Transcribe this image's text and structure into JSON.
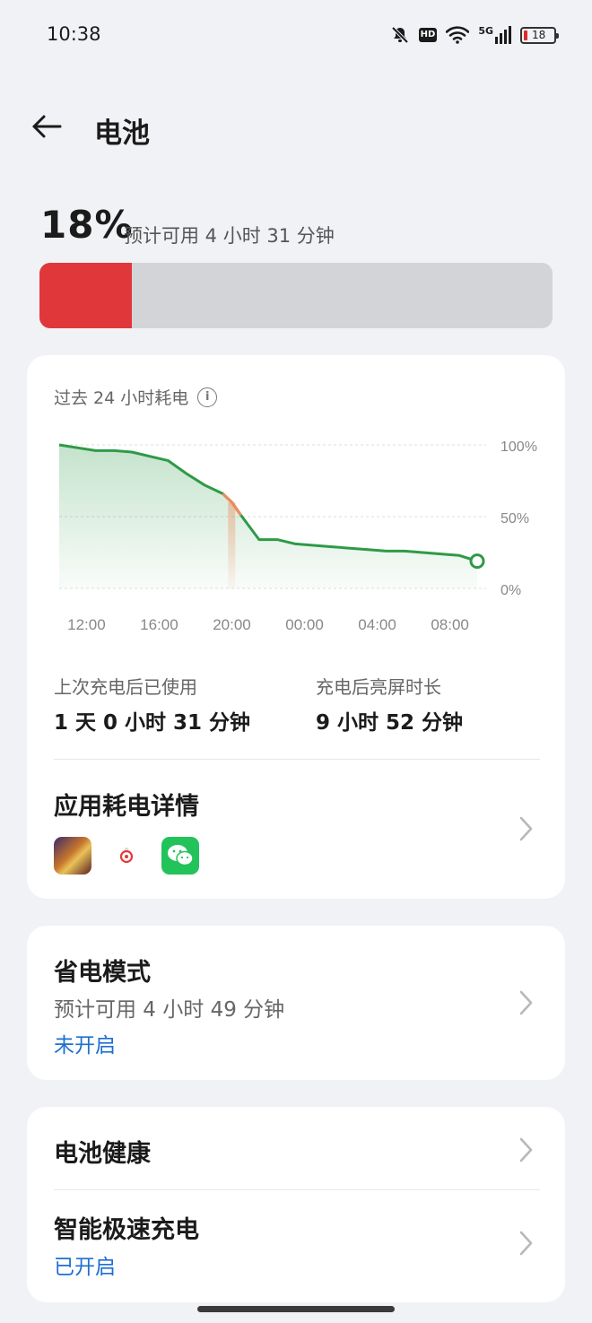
{
  "status": {
    "time": "10:38",
    "icons": [
      "mute-bell-icon",
      "hd-icon",
      "wifi-icon",
      "5g-signal-icon",
      "battery-icon"
    ],
    "hd_label": "HD",
    "net_label": "5G",
    "battery_level": "18"
  },
  "header": {
    "title": "电池"
  },
  "battery": {
    "percent_text": "18%",
    "percent_value": 18,
    "estimate": "预计可用 4 小时 31 分钟",
    "fill_color": "#e0383a"
  },
  "usage_card": {
    "title": "过去 24 小时耗电",
    "last_charge_label": "上次充电后已使用",
    "last_charge_value": "1 天 0 小时 31 分钟",
    "screen_on_label": "充电后亮屏时长",
    "screen_on_value": "9 小时 52 分钟",
    "app_details_title": "应用耗电详情",
    "apps": [
      "game-app-icon",
      "music-app-icon",
      "wechat-app-icon"
    ]
  },
  "chart_data": {
    "type": "area",
    "x_tick_labels": [
      "12:00",
      "16:00",
      "20:00",
      "00:00",
      "04:00",
      "08:00"
    ],
    "y_tick_labels": [
      "100%",
      "50%",
      "0%"
    ],
    "ylim": [
      0,
      100
    ],
    "grid": true,
    "series": [
      {
        "x": [
          10.5,
          11.5,
          12.5,
          13.5,
          14.5,
          15.5,
          16.5,
          17.5,
          18.5,
          19.5,
          20.0,
          20.5,
          21.5,
          22.5,
          23.5,
          0.5,
          1.5,
          2.5,
          3.5,
          4.5,
          5.5,
          6.5,
          7.5,
          8.5,
          9.5
        ],
        "values": [
          100,
          98,
          96,
          96,
          95,
          92,
          89,
          80,
          72,
          66,
          60,
          51,
          34,
          34,
          31,
          30,
          29,
          28,
          27,
          26,
          26,
          25,
          24,
          23,
          19
        ],
        "color": "#2e9a48"
      }
    ],
    "highlight_segment": {
      "from_x": 19.5,
      "to_x": 20.5,
      "color": "#f08a5a"
    }
  },
  "power_saving": {
    "title": "省电模式",
    "estimate": "预计可用 4 小时 49 分钟",
    "status": "未开启"
  },
  "battery_health": {
    "title": "电池健康"
  },
  "fast_charge": {
    "title": "智能极速充电",
    "status": "已开启"
  },
  "colors": {
    "accent_blue": "#1f6fd1",
    "chart_green": "#2e9a48",
    "battery_red": "#e0383a"
  }
}
